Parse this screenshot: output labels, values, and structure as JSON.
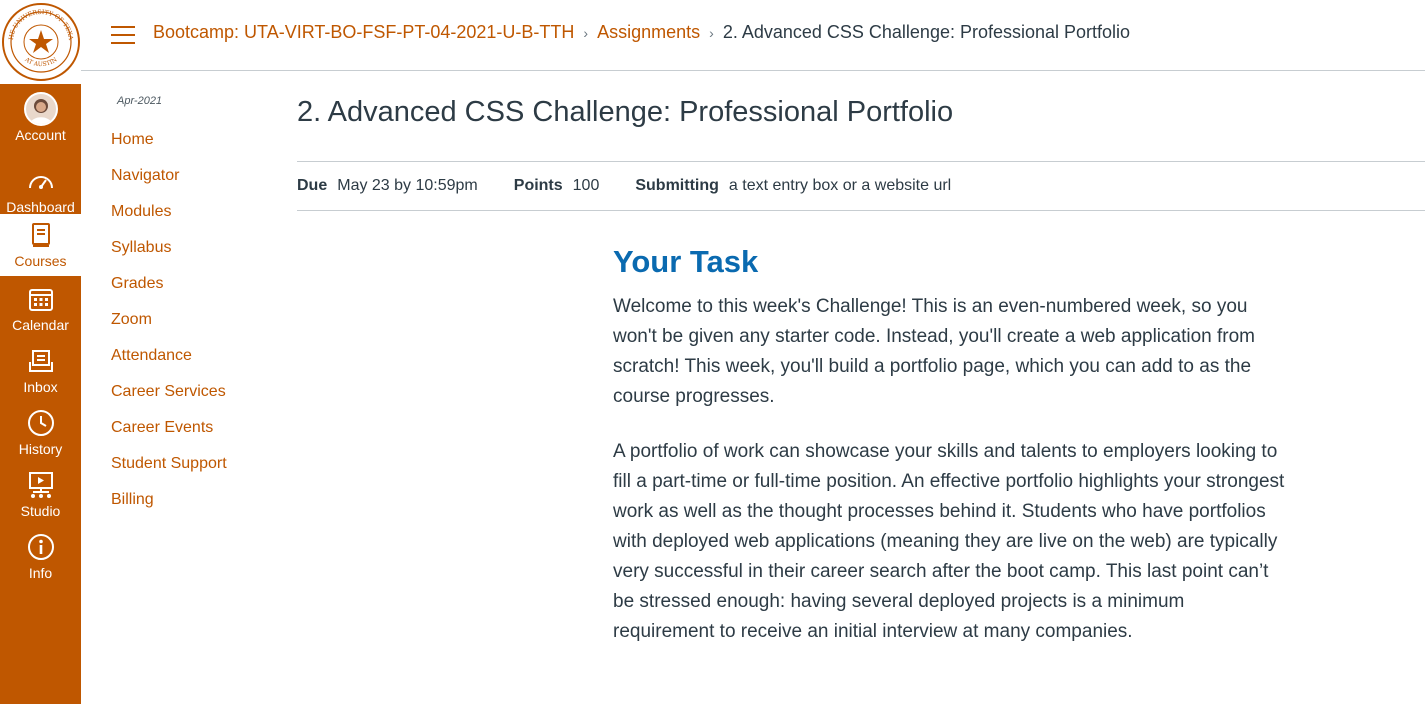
{
  "colors": {
    "brand": "#bf5700",
    "heading": "#0a6ab0",
    "text": "#2d3b45"
  },
  "logo": {
    "name": "University of Texas at Austin seal",
    "ring_text_top": "THE UNIVERSITY OF TEXAS",
    "ring_text_bottom": "AT AUSTIN"
  },
  "global_nav": {
    "items": [
      {
        "label": "Account",
        "icon": "avatar"
      },
      {
        "label": "Dashboard",
        "icon": "dashboard-icon"
      },
      {
        "label": "Courses",
        "icon": "book-icon",
        "active": true
      },
      {
        "label": "Calendar",
        "icon": "calendar-icon"
      },
      {
        "label": "Inbox",
        "icon": "inbox-icon"
      },
      {
        "label": "History",
        "icon": "clock-icon"
      },
      {
        "label": "Studio",
        "icon": "studio-icon"
      },
      {
        "label": "Info",
        "icon": "info-icon"
      }
    ]
  },
  "breadcrumb": {
    "course": "Bootcamp: UTA-VIRT-BO-FSF-PT-04-2021-U-B-TTH",
    "section": "Assignments",
    "current": "2. Advanced CSS Challenge: Professional Portfolio",
    "separator": "›"
  },
  "course_nav": {
    "term": "Apr-2021",
    "items": [
      "Home",
      "Navigator",
      "Modules",
      "Syllabus",
      "Grades",
      "Zoom",
      "Attendance",
      "Career Services",
      "Career Events",
      "Student Support",
      "Billing"
    ]
  },
  "assignment": {
    "title": "2. Advanced CSS Challenge: Professional Portfolio",
    "due_label": "Due",
    "due_value": "May 23 by 10:59pm",
    "points_label": "Points",
    "points_value": "100",
    "submitting_label": "Submitting",
    "submitting_value": "a text entry box or a website url",
    "heading": "Your Task",
    "paragraphs": [
      "Welcome to this week's Challenge! This is an even-numbered week, so you won't be given any starter code. Instead, you'll create a web application from scratch! This week, you'll build a portfolio page, which you can add to as the course progresses.",
      "A portfolio of work can showcase your skills and talents to employers looking to fill a part-time or full-time position. An effective portfolio highlights your strongest work as well as the thought processes behind it. Students who have portfolios with deployed web applications (meaning they are live on the web) are typically very successful in their career search after the boot camp. This last point can’t be stressed enough: having several deployed projects is a minimum requirement to receive an initial interview at many companies."
    ]
  }
}
